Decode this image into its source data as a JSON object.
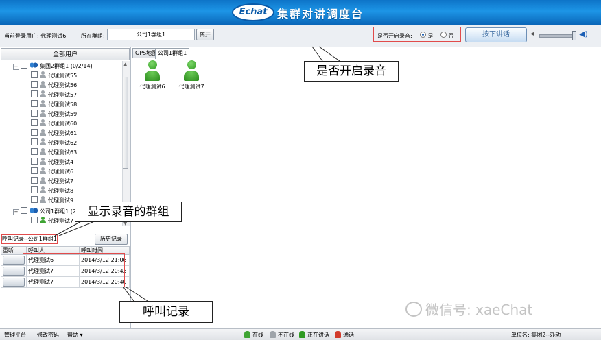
{
  "header": {
    "logo_text": "Echat",
    "title": "集群对讲调度台"
  },
  "toolbar": {
    "current_user_label": "当前登录用户: 代理测试6",
    "group_label": "所在群组:",
    "group_value": "公司1群组1",
    "leave_label": "离开",
    "recording_label": "是否开启录音:",
    "recording_yes": "是",
    "recording_no": "否",
    "recording_selected": "是",
    "ptt_label": "按下讲话"
  },
  "left_panel": {
    "all_users_label": "全部用户",
    "tree": [
      {
        "type": "group",
        "label": "集团2群组1 (0/2/14)"
      },
      {
        "type": "user",
        "label": "代理测试55",
        "status": "offline"
      },
      {
        "type": "user",
        "label": "代理测试56",
        "status": "offline"
      },
      {
        "type": "user",
        "label": "代理测试57",
        "status": "offline"
      },
      {
        "type": "user",
        "label": "代理测试58",
        "status": "offline"
      },
      {
        "type": "user",
        "label": "代理测试59",
        "status": "offline"
      },
      {
        "type": "user",
        "label": "代理测试60",
        "status": "offline"
      },
      {
        "type": "user",
        "label": "代理测试61",
        "status": "offline"
      },
      {
        "type": "user",
        "label": "代理测试62",
        "status": "offline"
      },
      {
        "type": "user",
        "label": "代理测试63",
        "status": "offline"
      },
      {
        "type": "user",
        "label": "代理测试4",
        "status": "offline"
      },
      {
        "type": "user",
        "label": "代理测试6",
        "status": "offline"
      },
      {
        "type": "user",
        "label": "代理测试7",
        "status": "offline"
      },
      {
        "type": "user",
        "label": "代理测试8",
        "status": "offline"
      },
      {
        "type": "user",
        "label": "代理测试9",
        "status": "offline"
      },
      {
        "type": "group",
        "label": "公司1群组1 (2/1"
      },
      {
        "type": "user",
        "label": "代理测试7",
        "status": "online"
      }
    ],
    "call_log_title": "呼叫记录--公司1群组1",
    "history_label": "历史记录",
    "table_headers": [
      "重听",
      "呼叫人",
      "呼叫时间"
    ],
    "call_records": [
      {
        "caller": "代理测试6",
        "time": "2014/3/12 21:06"
      },
      {
        "caller": "代理测试7",
        "time": "2014/3/12 20:43"
      },
      {
        "caller": "代理测试7",
        "time": "2014/3/12 20:40"
      }
    ]
  },
  "tabs": [
    {
      "label": "GPS地图"
    },
    {
      "label": "公司1群组1"
    }
  ],
  "members": [
    {
      "label": "代理测试6"
    },
    {
      "label": "代理测试7"
    }
  ],
  "callouts": {
    "recording_switch": "是否开启录音",
    "recording_group": "显示录音的群组",
    "call_records": "呼叫记录"
  },
  "status_bar": {
    "platform_label": "管理平台",
    "change_password_label": "修改密码",
    "help_label": "帮助",
    "legend": [
      {
        "label": "在线",
        "color": "#3fa433"
      },
      {
        "label": "不在线",
        "color": "#9ea4aa"
      },
      {
        "label": "正在讲话",
        "color": "#2f9a22"
      },
      {
        "label": "通话",
        "color": "#d23b2b"
      }
    ],
    "unit_label": "单位名: 集团2--办动"
  },
  "watermark": "微信号: xaeChat",
  "colors": {
    "header_blue": "#1d95e6",
    "annotation_red": "#e14b4b",
    "online_green": "#3fa433"
  }
}
